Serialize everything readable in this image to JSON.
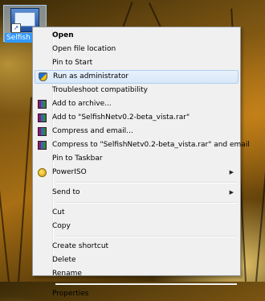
{
  "desktop": {
    "icon_label": "Selfish"
  },
  "context_menu": {
    "items": [
      {
        "type": "item",
        "label": "Open",
        "bold": true
      },
      {
        "type": "item",
        "label": "Open file location"
      },
      {
        "type": "item",
        "label": "Pin to Start"
      },
      {
        "type": "item",
        "label": "Run as administrator",
        "icon": "uac-shield-icon",
        "highlighted": true
      },
      {
        "type": "item",
        "label": "Troubleshoot compatibility"
      },
      {
        "type": "item",
        "label": "Add to archive...",
        "icon": "winrar-icon"
      },
      {
        "type": "item",
        "label": "Add to \"SelfishNetv0.2-beta_vista.rar\"",
        "icon": "winrar-icon"
      },
      {
        "type": "item",
        "label": "Compress and email...",
        "icon": "winrar-icon"
      },
      {
        "type": "item",
        "label": "Compress to \"SelfishNetv0.2-beta_vista.rar\" and email",
        "icon": "winrar-icon"
      },
      {
        "type": "item",
        "label": "Pin to Taskbar"
      },
      {
        "type": "item",
        "label": "PowerISO",
        "icon": "poweriso-icon",
        "submenu": true
      },
      {
        "type": "sep"
      },
      {
        "type": "item",
        "label": "Send to",
        "submenu": true
      },
      {
        "type": "sep"
      },
      {
        "type": "item",
        "label": "Cut"
      },
      {
        "type": "item",
        "label": "Copy"
      },
      {
        "type": "sep"
      },
      {
        "type": "item",
        "label": "Create shortcut"
      },
      {
        "type": "item",
        "label": "Delete"
      },
      {
        "type": "item",
        "label": "Rename"
      },
      {
        "type": "sep"
      },
      {
        "type": "item",
        "label": "Properties"
      }
    ],
    "submenu_glyph": "▶"
  }
}
